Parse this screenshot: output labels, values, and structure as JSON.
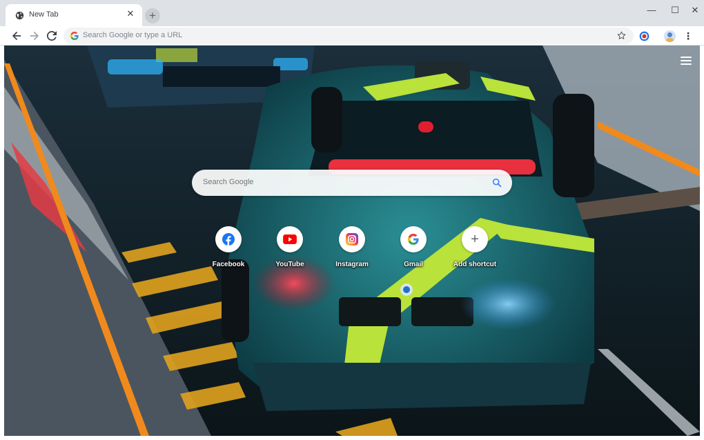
{
  "tab": {
    "title": "New Tab",
    "close_glyph": "✕",
    "favicon": "globe-icon"
  },
  "new_tab_glyph": "+",
  "window_controls": {
    "minimize": "—",
    "maximize": "☐",
    "close": "✕"
  },
  "omnibox": {
    "placeholder": "Search Google or type a URL"
  },
  "toolbar_menu_glyph": "⋮",
  "search": {
    "placeholder": "Search Google"
  },
  "shortcuts": [
    {
      "label": "Facebook",
      "icon": "facebook-icon",
      "color": "#1877f2"
    },
    {
      "label": "YouTube",
      "icon": "youtube-icon",
      "color": "#ff0000"
    },
    {
      "label": "Instagram",
      "icon": "instagram-icon",
      "color": "#c13584"
    },
    {
      "label": "Gmail",
      "icon": "google-icon",
      "color": "#4285f4"
    },
    {
      "label": "Add shortcut",
      "icon": "plus-icon",
      "color": "#5f6368"
    }
  ],
  "add_shortcut_glyph": "+",
  "background": {
    "subject": "car-wallpaper"
  }
}
